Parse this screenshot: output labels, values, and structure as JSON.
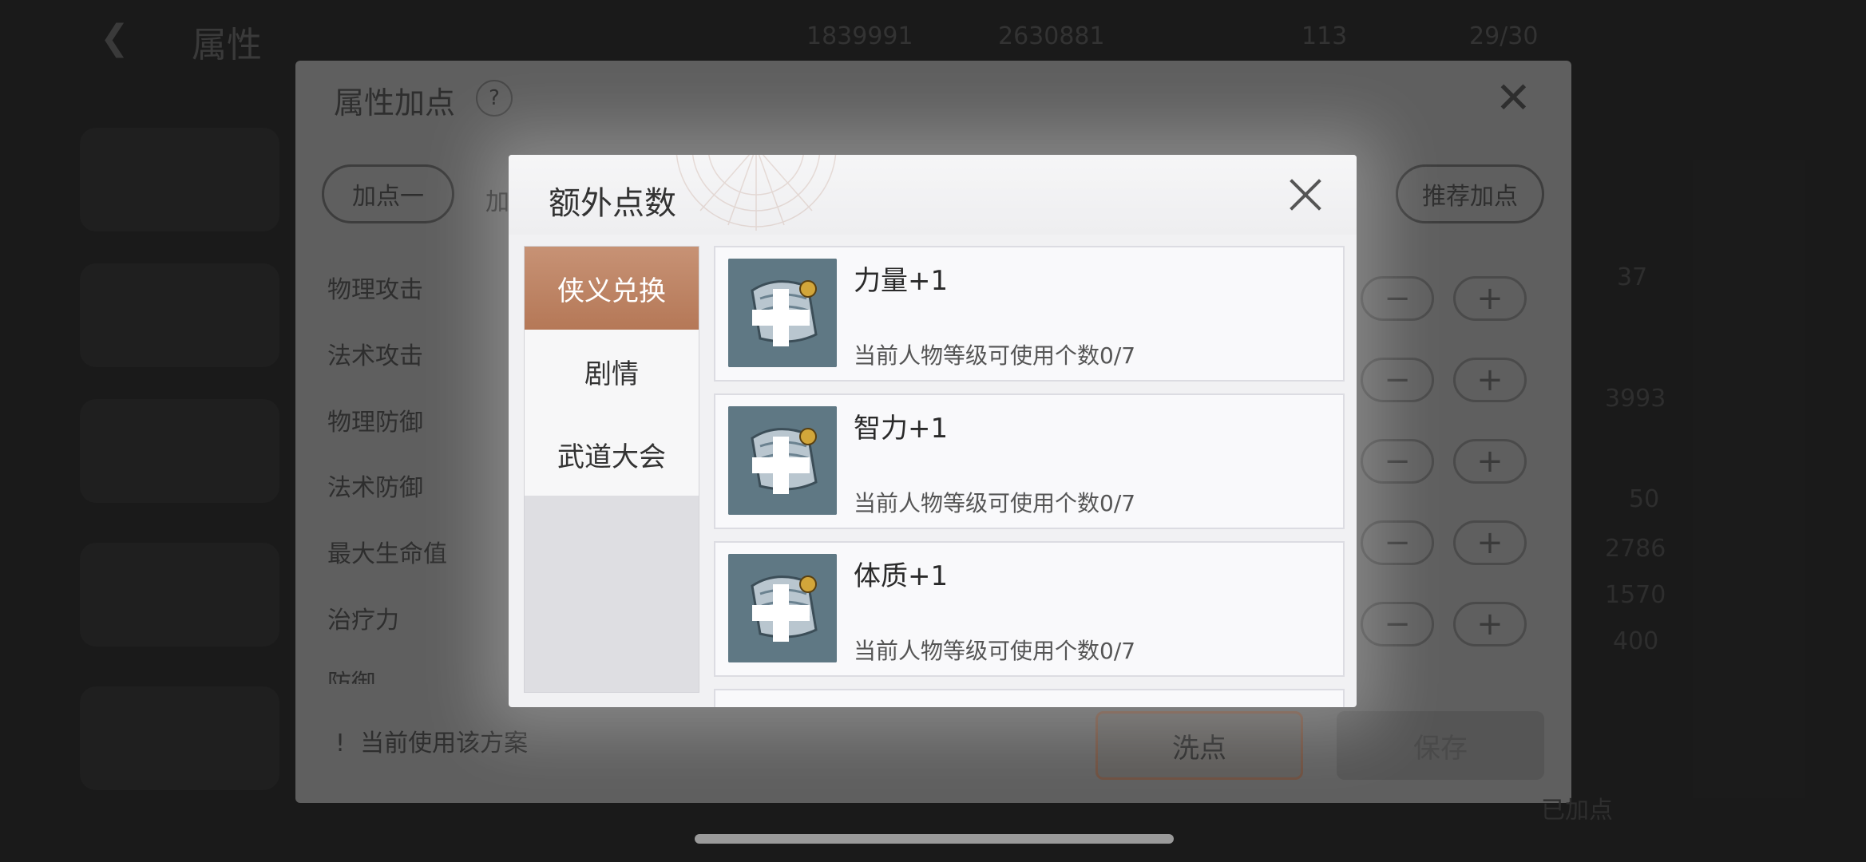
{
  "background": {
    "title": "属性",
    "resources": [
      "1839991",
      "2630881",
      "113",
      "29/30"
    ]
  },
  "attr_panel": {
    "title": "属性加点",
    "help_icon": "?",
    "plan_tab": "加点一",
    "plan_tab_partial": "加",
    "recommend_label": "推荐加点",
    "rows": [
      "物理攻击",
      "法术攻击",
      "物理防御",
      "法术防御",
      "最大生命值",
      "治疗力",
      "防御"
    ],
    "right_values": [
      "37",
      "3993",
      "50",
      "2786",
      "1570",
      "400"
    ],
    "footer_note": "当前使用该方案",
    "wash_label": "洗点",
    "save_label": "保存",
    "bottom_note": "已加点"
  },
  "modal": {
    "title": "额外点数",
    "tabs": [
      {
        "label": "侠义兑换",
        "active": true
      },
      {
        "label": "剧情",
        "active": false
      },
      {
        "label": "武道大会",
        "active": false
      }
    ],
    "items": [
      {
        "name": "力量+1",
        "desc": "当前人物等级可使用个数0/7"
      },
      {
        "name": "智力+1",
        "desc": "当前人物等级可使用个数0/7"
      },
      {
        "name": "体质+1",
        "desc": "当前人物等级可使用个数0/7"
      }
    ]
  },
  "colors": {
    "active_tab": "#b57857",
    "modal_bg": "#f1f1f3",
    "icon_bg": "#5f7884"
  }
}
